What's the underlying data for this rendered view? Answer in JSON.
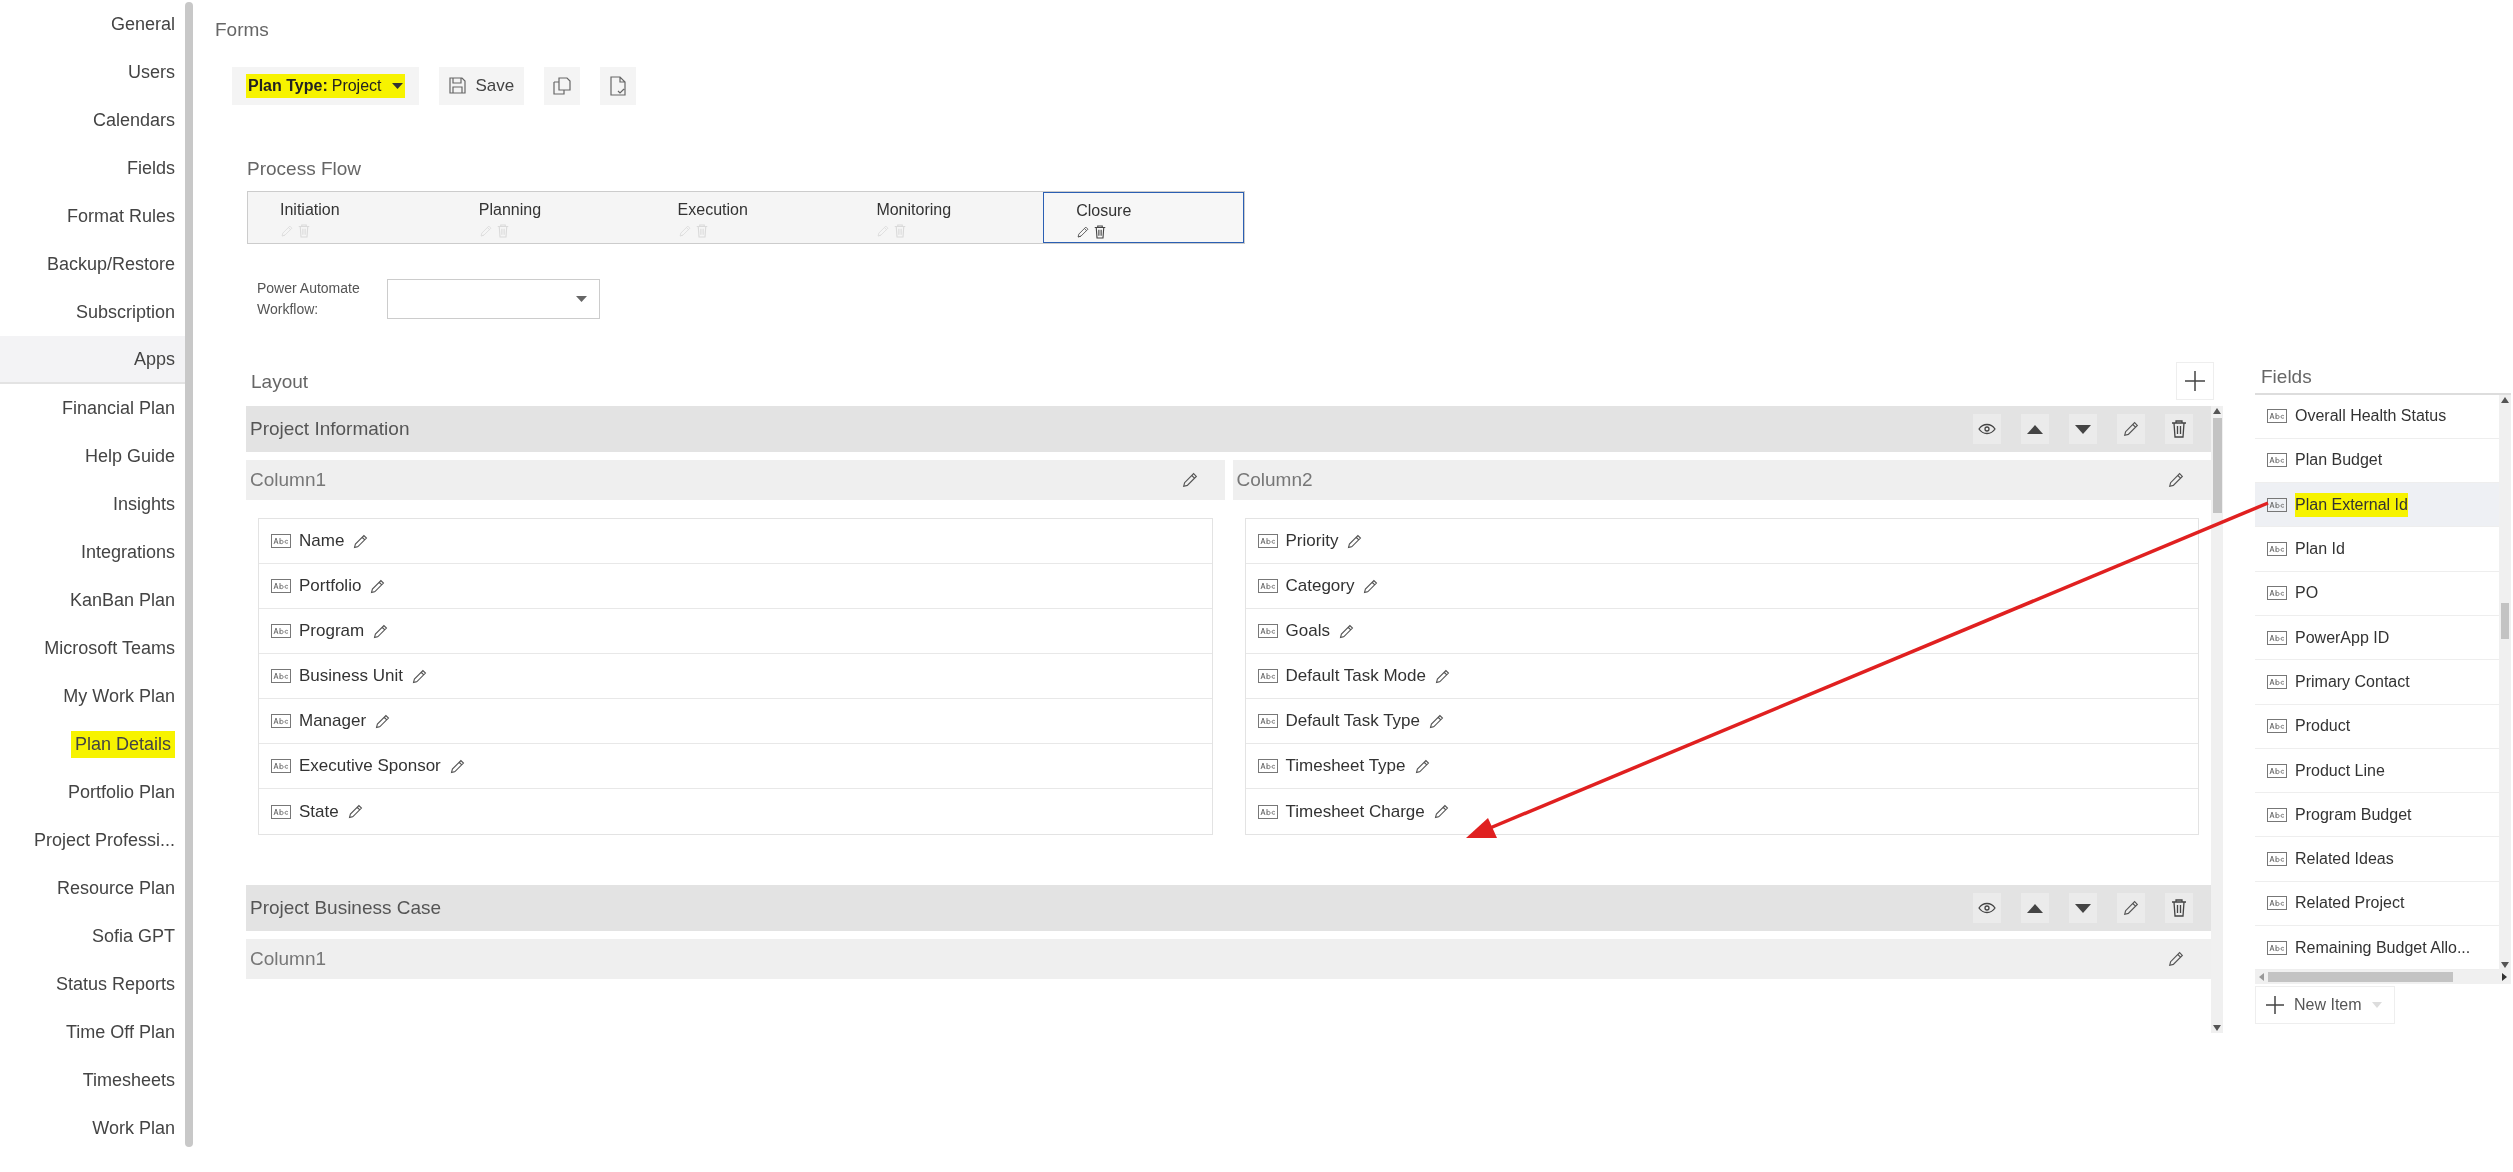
{
  "sidebar": {
    "items": [
      {
        "label": "General",
        "kind": "link",
        "selected": false,
        "highlighted": false
      },
      {
        "label": "Users",
        "kind": "link",
        "selected": false,
        "highlighted": false
      },
      {
        "label": "Calendars",
        "kind": "link",
        "selected": false,
        "highlighted": false
      },
      {
        "label": "Fields",
        "kind": "link",
        "selected": false,
        "highlighted": false
      },
      {
        "label": "Format Rules",
        "kind": "link",
        "selected": false,
        "highlighted": false
      },
      {
        "label": "Backup/Restore",
        "kind": "link",
        "selected": false,
        "highlighted": false
      },
      {
        "label": "Subscription",
        "kind": "link",
        "selected": false,
        "highlighted": false
      },
      {
        "label": "Apps",
        "kind": "group",
        "selected": false,
        "highlighted": false
      },
      {
        "label": "Financial Plan",
        "kind": "link",
        "selected": false,
        "highlighted": false
      },
      {
        "label": "Help Guide",
        "kind": "link",
        "selected": false,
        "highlighted": false
      },
      {
        "label": "Insights",
        "kind": "link",
        "selected": false,
        "highlighted": false
      },
      {
        "label": "Integrations",
        "kind": "link",
        "selected": false,
        "highlighted": false
      },
      {
        "label": "KanBan Plan",
        "kind": "link",
        "selected": false,
        "highlighted": false
      },
      {
        "label": "Microsoft Teams",
        "kind": "link",
        "selected": false,
        "highlighted": false
      },
      {
        "label": "My Work Plan",
        "kind": "link",
        "selected": false,
        "highlighted": false
      },
      {
        "label": "Plan Details",
        "kind": "link",
        "selected": true,
        "highlighted": true
      },
      {
        "label": "Portfolio Plan",
        "kind": "link",
        "selected": false,
        "highlighted": false
      },
      {
        "label": "Project Professi...",
        "kind": "link",
        "selected": false,
        "highlighted": false
      },
      {
        "label": "Resource Plan",
        "kind": "link",
        "selected": false,
        "highlighted": false
      },
      {
        "label": "Sofia GPT",
        "kind": "link",
        "selected": false,
        "highlighted": false
      },
      {
        "label": "Status Reports",
        "kind": "link",
        "selected": false,
        "highlighted": false
      },
      {
        "label": "Time Off Plan",
        "kind": "link",
        "selected": false,
        "highlighted": false
      },
      {
        "label": "Timesheets",
        "kind": "link",
        "selected": false,
        "highlighted": false
      },
      {
        "label": "Work Plan",
        "kind": "link",
        "selected": false,
        "highlighted": false
      }
    ]
  },
  "page_title": "Forms",
  "toolbar": {
    "plan_type": {
      "label": "Plan Type:",
      "value": "Project",
      "highlighted": true
    },
    "save": "Save"
  },
  "process_flow": {
    "title": "Process Flow",
    "steps": [
      {
        "label": "Initiation",
        "selected": false
      },
      {
        "label": "Planning",
        "selected": false
      },
      {
        "label": "Execution",
        "selected": false
      },
      {
        "label": "Monitoring",
        "selected": false
      },
      {
        "label": "Closure",
        "selected": true
      }
    ]
  },
  "workflow": {
    "label": "Power Automate Workflow:"
  },
  "layout": {
    "title": "Layout",
    "sections": [
      {
        "title": "Project Information",
        "columns": [
          {
            "title": "Column1",
            "fields": [
              "Name",
              "Portfolio",
              "Program",
              "Business Unit",
              "Manager",
              "Executive Sponsor",
              "State"
            ]
          },
          {
            "title": "Column2",
            "fields": [
              "Priority",
              "Category",
              "Goals",
              "Default Task Mode",
              "Default Task Type",
              "Timesheet Type",
              "Timesheet Charge"
            ]
          }
        ]
      },
      {
        "title": "Project Business Case",
        "columns": [
          {
            "title": "Column1"
          }
        ]
      }
    ]
  },
  "fields_panel": {
    "title": "Fields",
    "items": [
      {
        "label": "Overall Health Status",
        "selected": false,
        "highlighted": false
      },
      {
        "label": "Plan Budget",
        "selected": false,
        "highlighted": false
      },
      {
        "label": "Plan External Id",
        "selected": true,
        "highlighted": true
      },
      {
        "label": "Plan Id",
        "selected": false,
        "highlighted": false
      },
      {
        "label": "PO",
        "selected": false,
        "highlighted": false
      },
      {
        "label": "PowerApp ID",
        "selected": false,
        "highlighted": false
      },
      {
        "label": "Primary Contact",
        "selected": false,
        "highlighted": false
      },
      {
        "label": "Product",
        "selected": false,
        "highlighted": false
      },
      {
        "label": "Product Line",
        "selected": false,
        "highlighted": false
      },
      {
        "label": "Program Budget",
        "selected": false,
        "highlighted": false
      },
      {
        "label": "Related Ideas",
        "selected": false,
        "highlighted": false
      },
      {
        "label": "Related Project",
        "selected": false,
        "highlighted": false
      },
      {
        "label": "Remaining Budget Allo...",
        "selected": false,
        "highlighted": false
      }
    ],
    "new_item": "New Item"
  }
}
